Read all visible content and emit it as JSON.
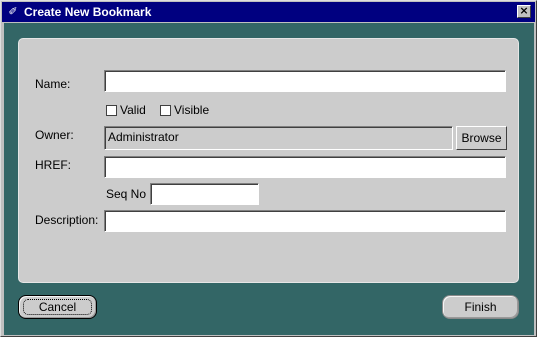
{
  "window": {
    "title": "Create New Bookmark",
    "close_glyph": "×",
    "icon": "bookmark-icon"
  },
  "form": {
    "name_label": "Name:",
    "name_value": "",
    "valid_label": "Valid",
    "valid_checked": false,
    "visible_label": "Visible",
    "visible_checked": false,
    "owner_label": "Owner:",
    "owner_value": "Administrator",
    "browse_label": "Browse",
    "href_label": "HREF:",
    "href_value": "",
    "seq_label": "Seq No",
    "seq_value": "",
    "description_label": "Description:",
    "description_value": ""
  },
  "footer": {
    "cancel_label": "Cancel",
    "finish_label": "Finish"
  },
  "colors": {
    "titlebar": "#000080",
    "background": "#336666",
    "panel": "#cccccc"
  }
}
